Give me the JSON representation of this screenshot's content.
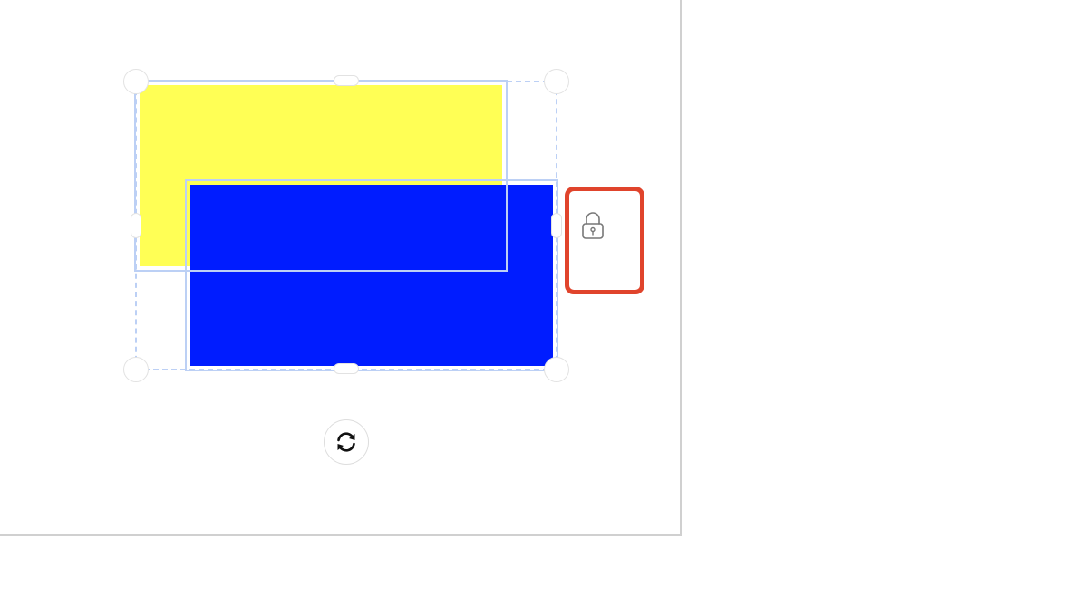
{
  "canvas": {
    "background": "#ffffff",
    "page_border_color": "#d0d0d0"
  },
  "shapes": [
    {
      "name": "yellow-rectangle",
      "color": "#ffff55"
    },
    {
      "name": "blue-rectangle",
      "color": "#001cff"
    }
  ],
  "selection": {
    "outline_color": "#bcd0f5",
    "handle_color": "#ffffff"
  },
  "controls": {
    "lock_icon": "lock-icon",
    "lock_highlight_color": "#e0442c",
    "rotate_icon": "rotate-icon"
  }
}
